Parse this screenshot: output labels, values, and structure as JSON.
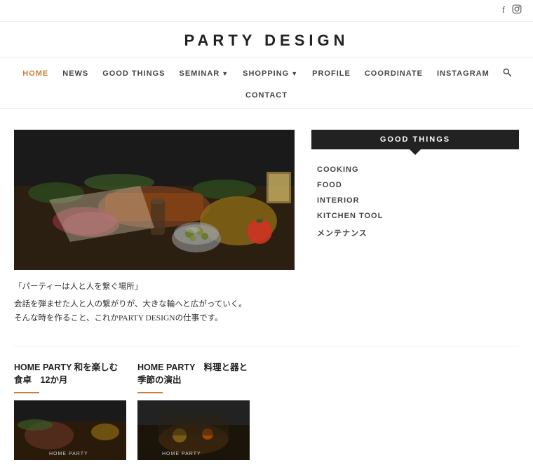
{
  "site": {
    "title": "PARTY DESIGN"
  },
  "topbar": {
    "facebook_icon": "f",
    "instagram_icon": "☐"
  },
  "nav": {
    "primary_items": [
      {
        "label": "HOME",
        "active": true,
        "has_dropdown": false
      },
      {
        "label": "NEWS",
        "active": false,
        "has_dropdown": false
      },
      {
        "label": "GOOD THINGS",
        "active": false,
        "has_dropdown": false
      },
      {
        "label": "SEMINAR",
        "active": false,
        "has_dropdown": true
      },
      {
        "label": "SHOPPING",
        "active": false,
        "has_dropdown": true
      },
      {
        "label": "PROFILE",
        "active": false,
        "has_dropdown": false
      },
      {
        "label": "COORDINATE",
        "active": false,
        "has_dropdown": false
      },
      {
        "label": "INSTAGRAM",
        "active": false,
        "has_dropdown": false
      }
    ],
    "secondary_items": [
      {
        "label": "CONTACT"
      }
    ]
  },
  "sidebar": {
    "title": "GOOD THINGS",
    "menu_items": [
      {
        "label": "COOKING"
      },
      {
        "label": "FOOD"
      },
      {
        "label": "INTERIOR"
      },
      {
        "label": "KITCHEN TOOL"
      },
      {
        "label": "メンテナンス"
      }
    ]
  },
  "hero": {
    "quote": "「パーティーは人と人を繋ぐ場所」",
    "description_line1": "会話を弾ませた人と人の繋がりが、大きな輪へと広がっていく。",
    "description_line2": "そんな時を作ること、これかPARTY DESIGNの仕事です。"
  },
  "cards": [
    {
      "title": "HOME PARTY 和を楽しむ食卓　12か月",
      "img_label": "HOME PARTY"
    },
    {
      "title": "HOME PARTY　料理と器と季節の演出",
      "img_label": "HOME PARTY"
    }
  ]
}
